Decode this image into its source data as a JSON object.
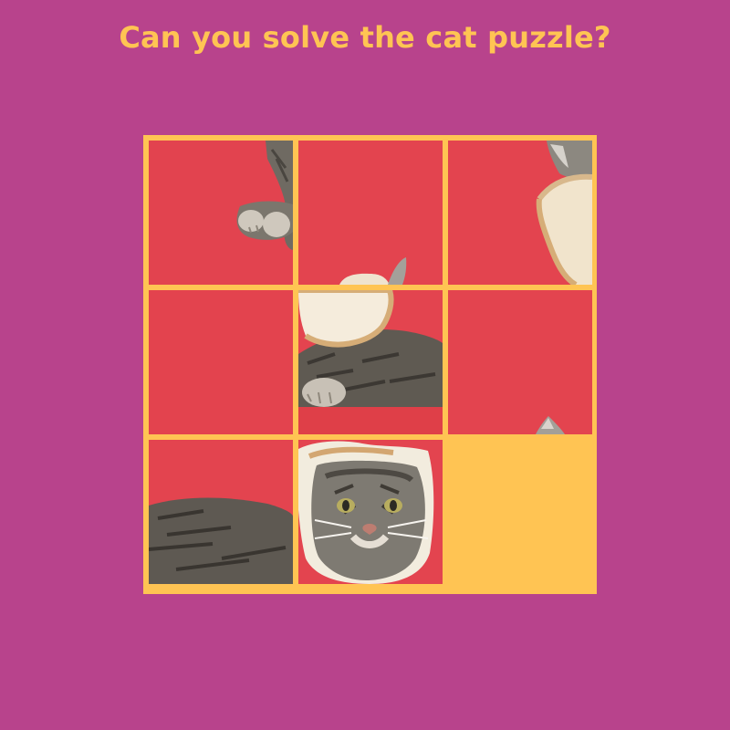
{
  "title": "Can you solve the cat puzzle?",
  "colors": {
    "background": "#b8438c",
    "accent": "#ffc453",
    "photo_red": "#e2434f"
  },
  "puzzle": {
    "grid": [
      3,
      3
    ],
    "tiles": [
      {
        "row": 1,
        "col": 1,
        "content": "cat paw on red"
      },
      {
        "row": 1,
        "col": 2,
        "content": "red background"
      },
      {
        "row": 1,
        "col": 3,
        "content": "cat ear and bread edge"
      },
      {
        "row": 2,
        "col": 1,
        "content": "red background"
      },
      {
        "row": 2,
        "col": 2,
        "content": "bread slice and cat paw"
      },
      {
        "row": 2,
        "col": 3,
        "content": "red with ear tip"
      },
      {
        "row": 3,
        "col": 1,
        "content": "cat body"
      },
      {
        "row": 3,
        "col": 2,
        "content": "cat face in bread"
      },
      {
        "row": 3,
        "col": 3,
        "content": "empty slot"
      }
    ],
    "empty_slot": {
      "row": 3,
      "col": 3
    }
  }
}
